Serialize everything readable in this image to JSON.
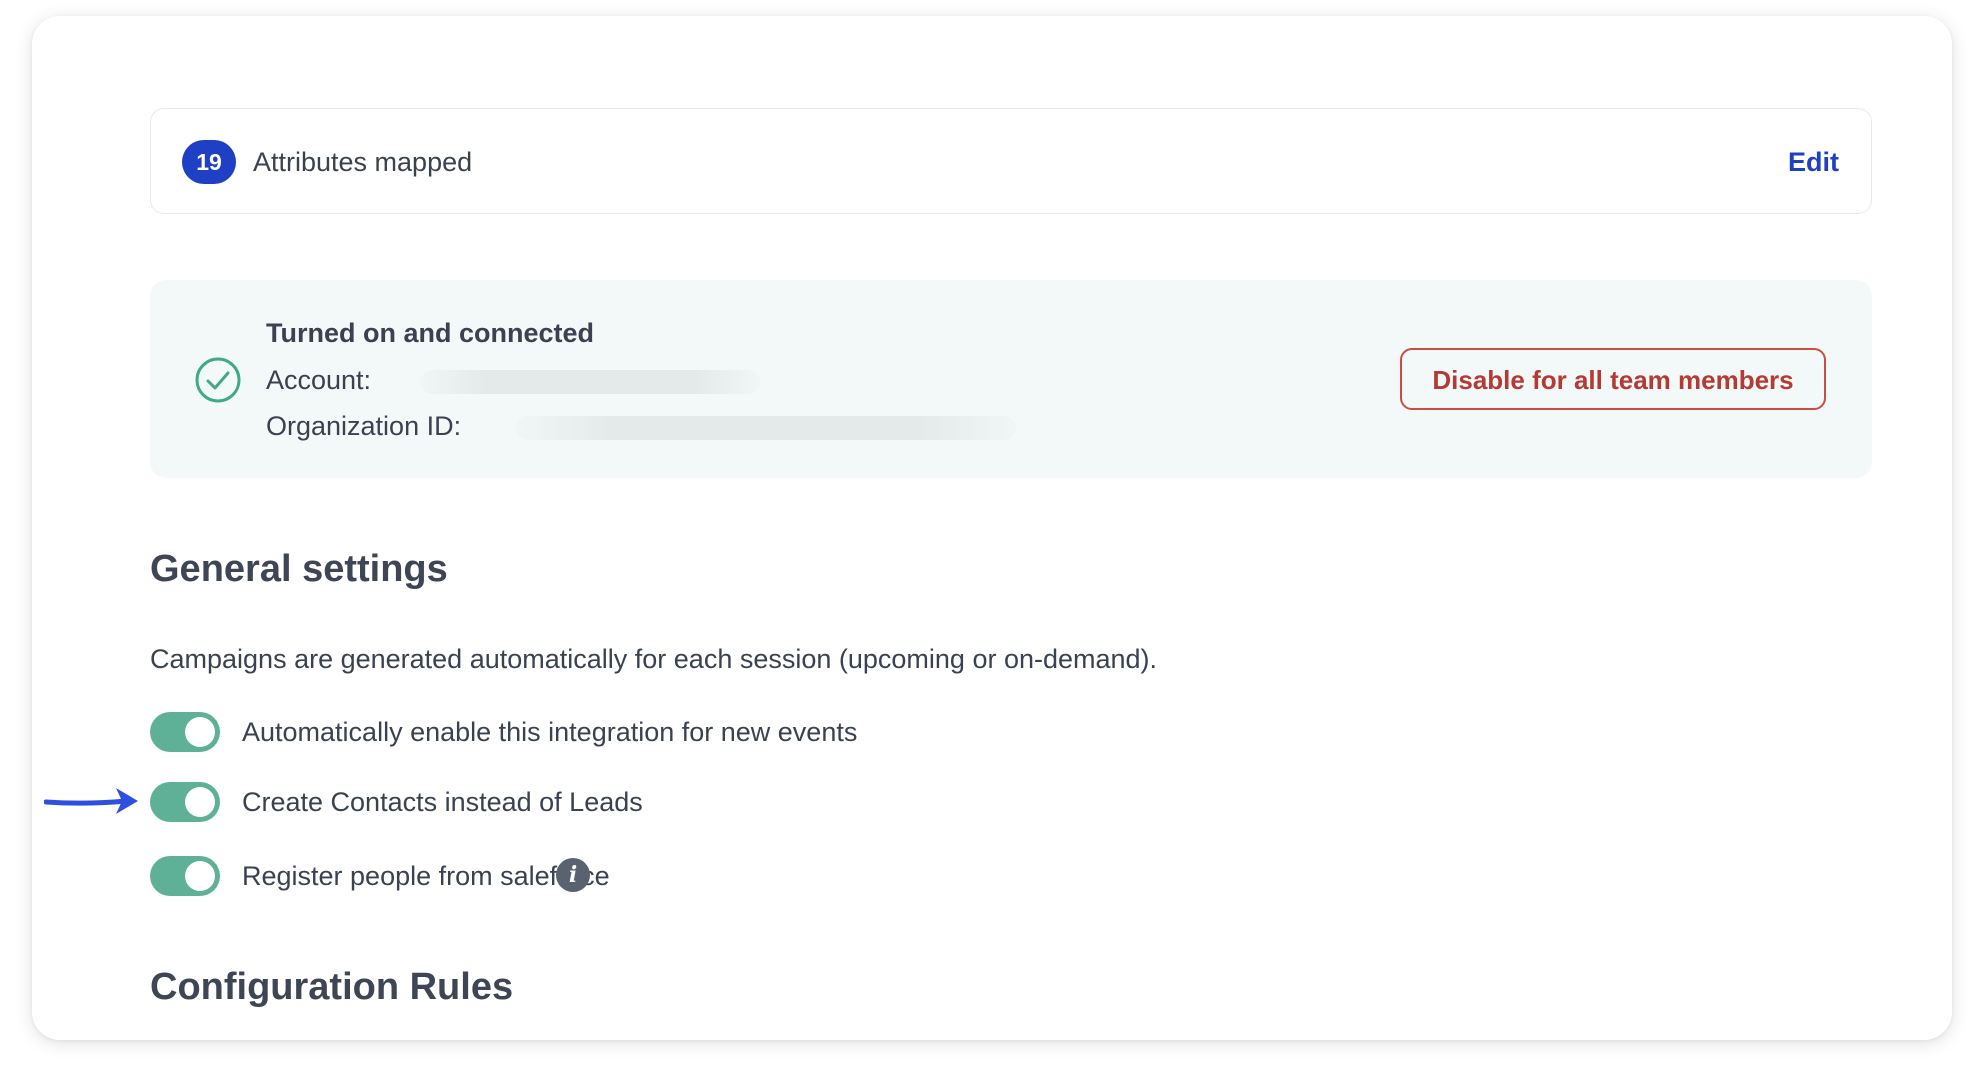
{
  "attributes": {
    "count": "19",
    "label": "Attributes mapped",
    "edit_label": "Edit"
  },
  "status": {
    "title": "Turned on and connected",
    "account_label": "Account:",
    "org_label": "Organization ID:",
    "disable_label": "Disable for all team members",
    "icon": "check-circle-icon",
    "color": "#3fa98a"
  },
  "general": {
    "title": "General settings",
    "description": "Campaigns are generated automatically for each session (upcoming or on-demand).",
    "toggles": [
      {
        "label": "Automatically enable this integration for new events",
        "on": true
      },
      {
        "label": "Create Contacts instead of Leads",
        "on": true
      },
      {
        "label": "Register people from saleforce",
        "on": true,
        "info_icon": "i"
      }
    ]
  },
  "config": {
    "title": "Configuration Rules"
  },
  "colors": {
    "brand": "#1f3fc4",
    "toggle_on": "#5eb096",
    "danger": "#b53a33",
    "annotation_arrow": "#2f4fe0"
  }
}
